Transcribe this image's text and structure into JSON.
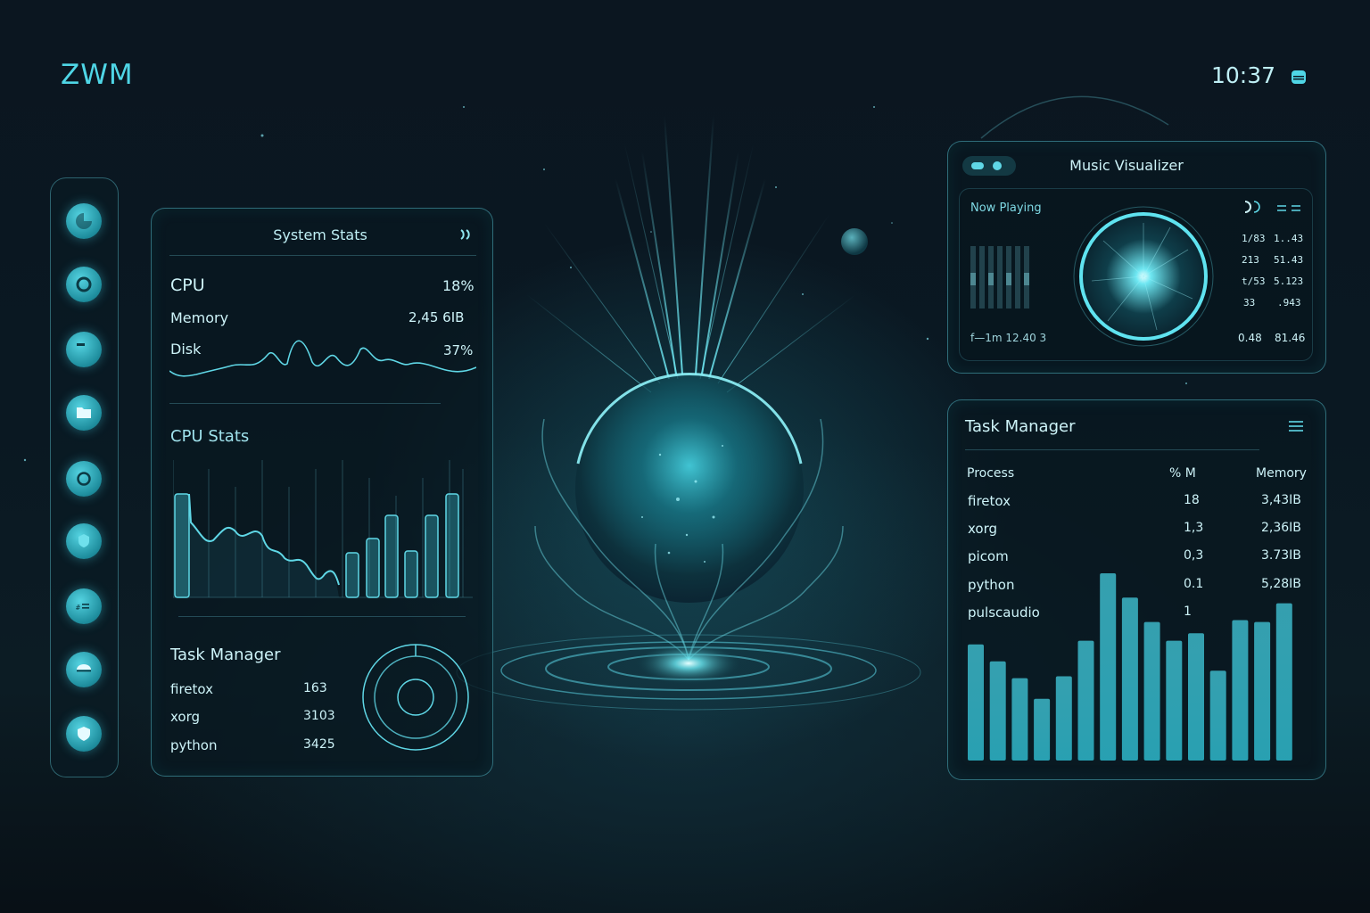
{
  "header": {
    "brand": "ZWM",
    "clock": "10:37"
  },
  "dock": {
    "items": [
      {
        "icon": "browser-icon"
      },
      {
        "icon": "ring-icon"
      },
      {
        "icon": "window-icon"
      },
      {
        "icon": "folder-icon"
      },
      {
        "icon": "circle-icon"
      },
      {
        "icon": "shield-icon"
      },
      {
        "icon": "terminal-icon"
      },
      {
        "icon": "chat-icon"
      },
      {
        "icon": "security-icon"
      }
    ]
  },
  "system_stats": {
    "title": "System Stats",
    "header_icon": "moon-icon",
    "cpu_label": "CPU",
    "cpu_value": "18%",
    "memory_label": "Memory",
    "memory_value": "2,45 6IB",
    "disk_label": "Disk",
    "disk_value": "37%",
    "cpu_stats_title": "CPU  Stats",
    "task_title": "Task Manager",
    "tasks": [
      {
        "name": "firetox",
        "value": "163"
      },
      {
        "name": "xorg",
        "value": "3103"
      },
      {
        "name": "python",
        "value": "3425"
      }
    ]
  },
  "music": {
    "title": "Music Visualizer",
    "now_playing": "Now Playing",
    "footer_left": "f—1m  12.40 3",
    "rows": [
      [
        "1/83",
        "1..43"
      ],
      [
        "213",
        "51.43"
      ],
      [
        "t/53",
        "5.123"
      ],
      [
        "33",
        ".943"
      ]
    ],
    "footer_right": [
      "0.48",
      "81.46"
    ]
  },
  "task_manager": {
    "title": "Task Manager",
    "menu_icon": "menu-icon",
    "columns": [
      "Process",
      "% M",
      "Memory"
    ],
    "rows": [
      {
        "process": "firetox",
        "pct": "18",
        "memory": "3,43IB"
      },
      {
        "process": "xorg",
        "pct": "1,3",
        "memory": "2,36IB"
      },
      {
        "process": "picom",
        "pct": "0,3",
        "memory": "3.73IB"
      },
      {
        "process": "python",
        "pct": "0.1",
        "memory": "5,28IB"
      },
      {
        "process": "pulscaudio",
        "pct": "1",
        "memory": ""
      }
    ],
    "bar_levels": [
      0.62,
      0.53,
      0.44,
      0.33,
      0.45,
      0.64,
      1.0,
      0.87,
      0.74,
      0.64,
      0.68,
      0.48,
      0.75,
      0.74,
      0.84
    ]
  },
  "colors": {
    "accent": "#4fd6e6",
    "panel_border": "#50b4c3",
    "background": "#0b1620"
  }
}
